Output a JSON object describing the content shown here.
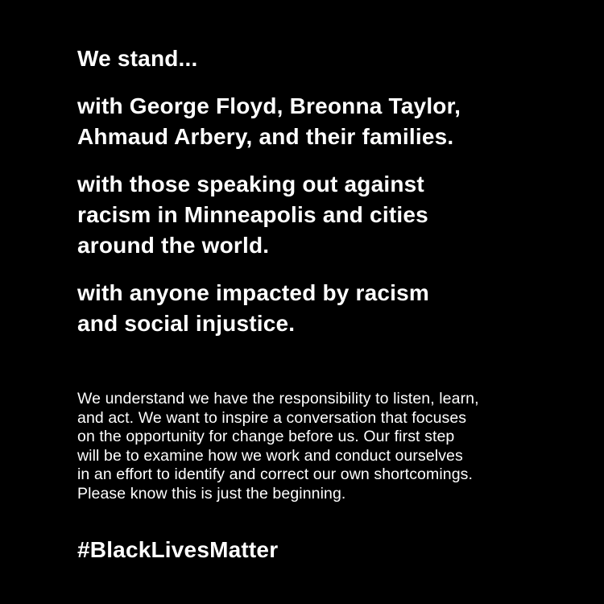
{
  "colors": {
    "background": "#000000",
    "text": "#ffffff"
  },
  "intro": "We stand...",
  "statements": [
    {
      "lines": [
        "with George Floyd, Breonna Taylor,",
        "Ahmaud Arbery, and their families."
      ]
    },
    {
      "lines": [
        "with those speaking out against",
        "racism in Minneapolis and cities",
        "around the world."
      ]
    },
    {
      "lines": [
        "with anyone impacted by racism",
        "and social injustice."
      ]
    }
  ],
  "body": {
    "lines": [
      "We understand we have the responsibility to listen, learn,",
      "and act. We want to inspire a conversation that focuses",
      "on the opportunity for change before us. Our first step",
      "will be to examine how we work and conduct ourselves",
      "in an effort to identify and correct our own shortcomings.",
      "Please know this is just the beginning."
    ]
  },
  "hashtag": "#BlackLivesMatter"
}
